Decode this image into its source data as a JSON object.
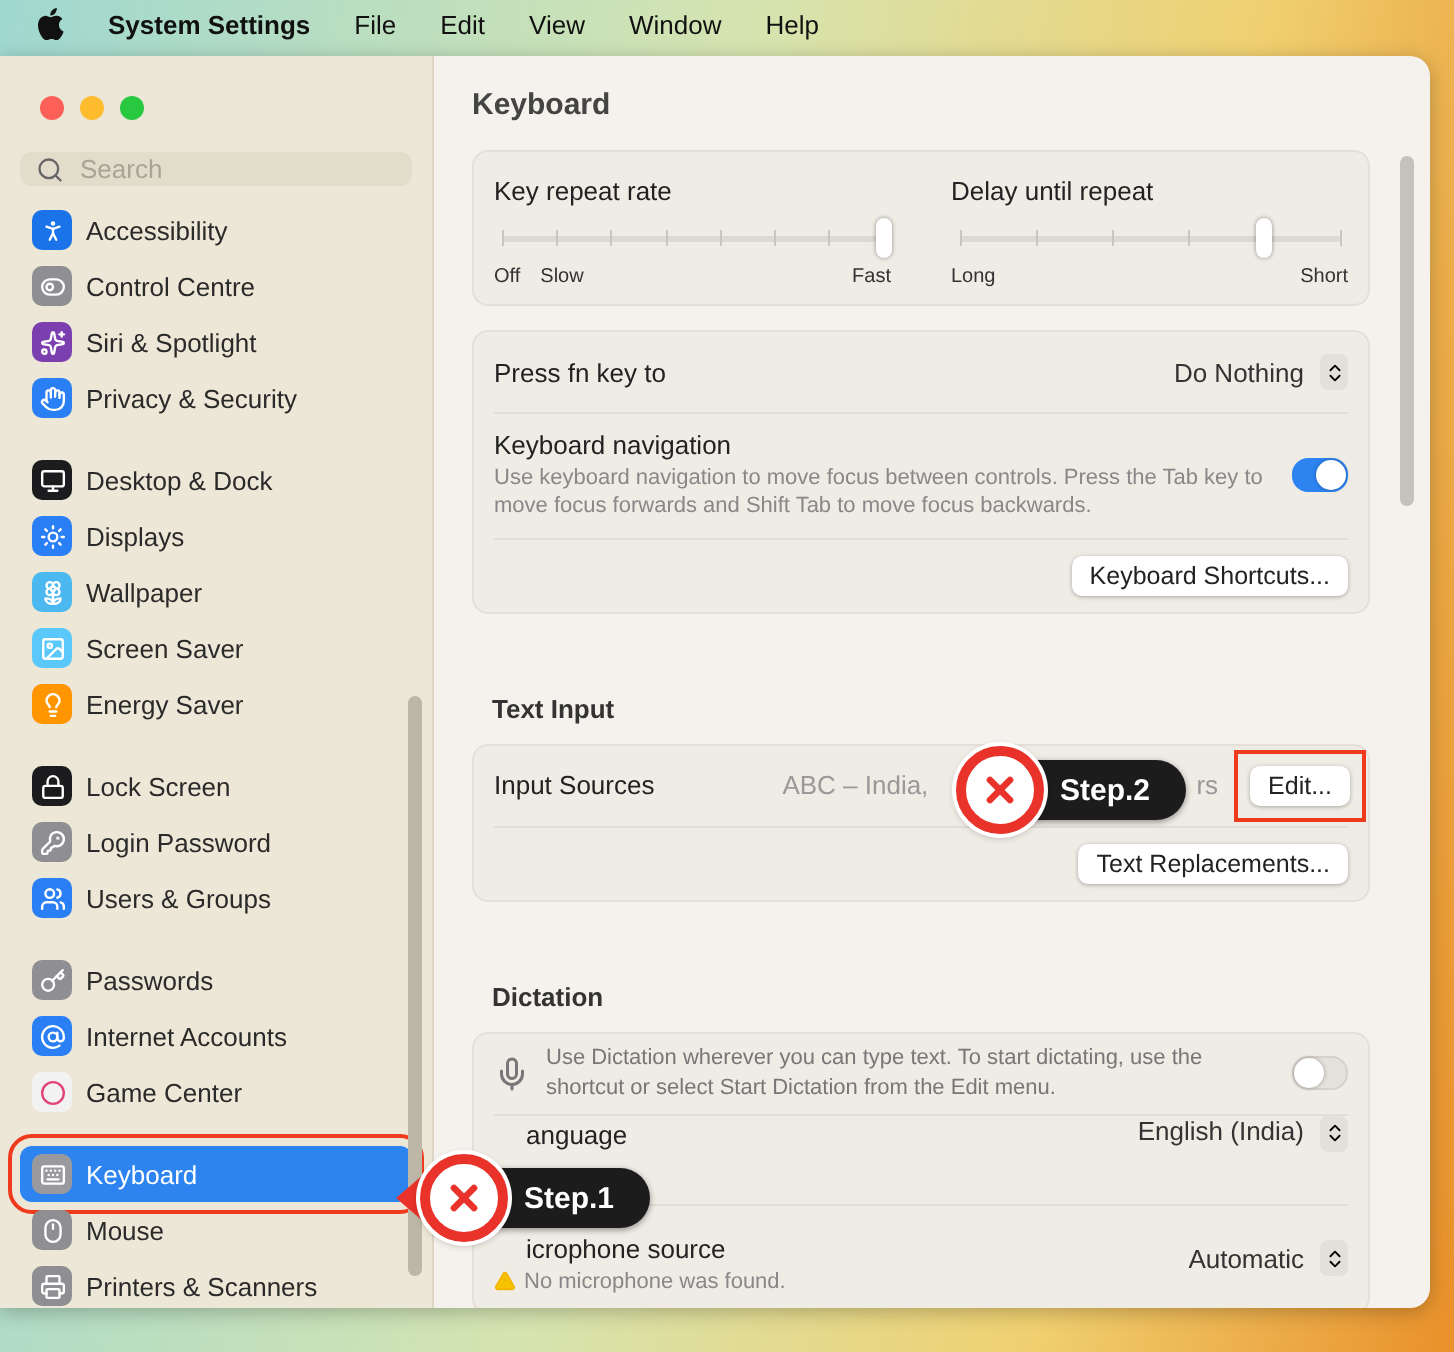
{
  "menu_bar": {
    "app": "System Settings",
    "items": [
      "File",
      "Edit",
      "View",
      "Window",
      "Help"
    ]
  },
  "sidebar": {
    "search": {
      "placeholder": "Search"
    },
    "groups": [
      [
        {
          "label": "Accessibility",
          "color": "#1a73e8",
          "selected": false
        },
        {
          "label": "Control Centre",
          "color": "#8e8e93",
          "selected": false
        },
        {
          "label": "Siri & Spotlight",
          "color": "#7b3fb0",
          "selected": false
        },
        {
          "label": "Privacy & Security",
          "color": "#2a7ff5",
          "selected": false
        }
      ],
      [
        {
          "label": "Desktop & Dock",
          "color": "#1c1c1e",
          "selected": false
        },
        {
          "label": "Displays",
          "color": "#2a7ff5",
          "selected": false
        },
        {
          "label": "Wallpaper",
          "color": "#4cb8f0",
          "selected": false
        },
        {
          "label": "Screen Saver",
          "color": "#5ac8fa",
          "selected": false
        },
        {
          "label": "Energy Saver",
          "color": "#ff9500",
          "selected": false
        }
      ],
      [
        {
          "label": "Lock Screen",
          "color": "#1c1c1e",
          "selected": false
        },
        {
          "label": "Login Password",
          "color": "#8e8e93",
          "selected": false
        },
        {
          "label": "Users & Groups",
          "color": "#2a7ff5",
          "selected": false
        }
      ],
      [
        {
          "label": "Passwords",
          "color": "#8e8e93",
          "selected": false
        },
        {
          "label": "Internet Accounts",
          "color": "#2a7ff5",
          "selected": false
        },
        {
          "label": "Game Center",
          "color": "#f2f2f2",
          "selected": false
        }
      ],
      [
        {
          "label": "Keyboard",
          "color": "#9a9a9e",
          "selected": true,
          "highlighted": true
        },
        {
          "label": "Mouse",
          "color": "#8e8e93",
          "selected": false
        },
        {
          "label": "Printers & Scanners",
          "color": "#8e8e93",
          "selected": false
        }
      ]
    ]
  },
  "content": {
    "title": "Keyboard",
    "sliders": [
      {
        "label": "Key repeat rate",
        "level": 1.0,
        "marks": [
          "Off",
          "Slow",
          "Fast"
        ]
      },
      {
        "label": "Delay until repeat",
        "level": 0.8,
        "marks": [
          "Long",
          "Short"
        ]
      }
    ],
    "fn_row": {
      "label": "Press fn key to",
      "value": "Do Nothing"
    },
    "navigation": {
      "label": "Keyboard navigation",
      "description": "Use keyboard navigation to move focus between controls. Press the Tab key to move focus forwards and Shift Tab to move focus backwards.",
      "on": true
    },
    "shortcuts_button": "Keyboard Shortcuts...",
    "text_input": {
      "heading": "Text Input",
      "label": "Input Sources",
      "value": "ABC – India,",
      "value_tail": "rs",
      "edit_button": {
        "label": "Edit...",
        "highlighted": true
      },
      "replacements_button": "Text Replacements..."
    },
    "dictation": {
      "heading": "Dictation",
      "description": "Use Dictation wherever you can type text. To start dictating, use the shortcut or select Start Dictation from the Edit menu.",
      "on": false,
      "rows": [
        {
          "label": "anguage",
          "value": "English (India)"
        },
        {
          "label": "icrophone source",
          "value": "Automatic",
          "warning": "No microphone was found."
        }
      ]
    }
  },
  "annotations": [
    {
      "label": "Step.1"
    },
    {
      "label": "Step.2"
    }
  ]
}
